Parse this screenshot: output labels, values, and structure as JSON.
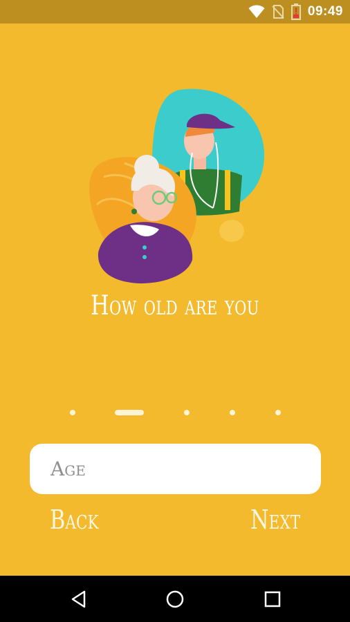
{
  "status_bar": {
    "time": "09:49",
    "icons": [
      "wifi-icon",
      "no-sim-icon",
      "battery-low-icon"
    ]
  },
  "onboarding": {
    "illustration": "elderly-woman-and-young-man-illustration",
    "question": "How old are you",
    "page_indicator": {
      "total": 5,
      "active_index": 1
    }
  },
  "age_input": {
    "placeholder": "Age",
    "value": ""
  },
  "buttons": {
    "back_label": "Back",
    "next_label": "Next"
  },
  "navigation_bar": {
    "icons": [
      "back-triangle-icon",
      "home-circle-icon",
      "recents-square-icon"
    ]
  },
  "colors": {
    "background": "#F2BA2C",
    "status_bar": "#BD8F20",
    "text": "#FFFFFF",
    "accent_teal": "#3CCCCB",
    "accent_purple": "#6E2F86"
  }
}
